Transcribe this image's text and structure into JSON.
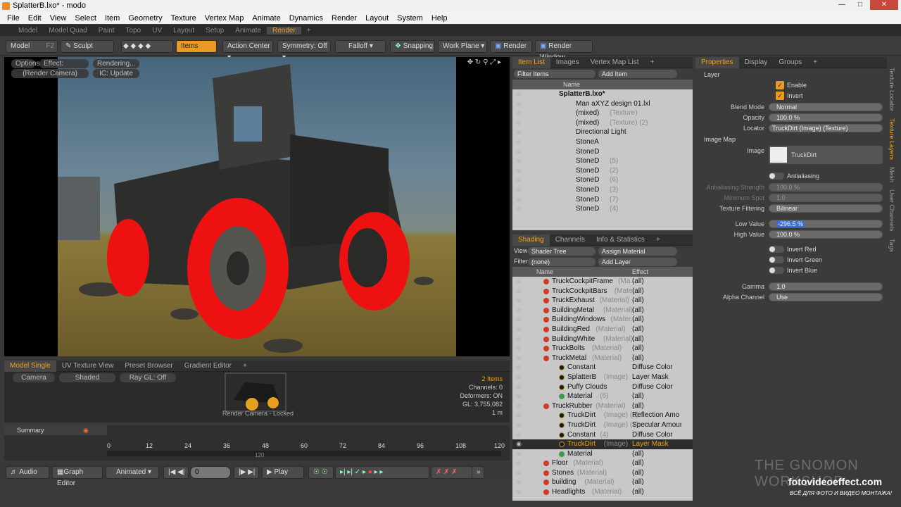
{
  "window": {
    "title": "SplatterB.lxo* - modo"
  },
  "menu": [
    "File",
    "Edit",
    "View",
    "Select",
    "Item",
    "Geometry",
    "Texture",
    "Vertex Map",
    "Animate",
    "Dynamics",
    "Render",
    "Layout",
    "System",
    "Help"
  ],
  "layout_tabs": [
    "Model",
    "Model Quad",
    "Paint",
    "Topo",
    "UV",
    "Layout",
    "Setup",
    "Animate",
    "Render"
  ],
  "toolbar": {
    "model": "Model",
    "model_key": "F2",
    "sculpt": "Sculpt",
    "items": "Items",
    "action_center": "Action Center",
    "symmetry": "Symmetry: Off",
    "falloff": "Falloff",
    "snapping": "Snapping",
    "work_plane": "Work Plane",
    "render": "Render",
    "render_window": "Render Window"
  },
  "viewport": {
    "options": "Options",
    "effect": "Effect: (Shadi...",
    "rendering": "Rendering...",
    "camera": "(Render Camera)",
    "ic": "IC: Update"
  },
  "bottom_tabs": [
    "Model Single",
    "UV Texture View",
    "Preset Browser",
    "Gradient Editor"
  ],
  "preview": {
    "camera": "Camera",
    "shaded": "Shaded",
    "raygl": "Ray GL: Off",
    "items": "2 Items",
    "channels": "Channels: 0",
    "deformers": "Deformers: ON",
    "gl": "GL: 3,755,082",
    "scale": "1 m",
    "locked": "Render Camera - Locked"
  },
  "timeline": {
    "summary": "Summary",
    "ticks": [
      "0",
      "12",
      "24",
      "36",
      "48",
      "60",
      "72",
      "84",
      "96",
      "108",
      "120"
    ],
    "end": "120"
  },
  "transport": {
    "audio": "Audio",
    "graph_editor": "Graph Editor",
    "animated": "Animated",
    "frame": "0",
    "play": "Play"
  },
  "item_list": {
    "tabs": [
      "Item List",
      "Images",
      "Vertex Map List"
    ],
    "filter": "Filter Items",
    "add": "Add Item",
    "col_name": "Name",
    "rows": [
      {
        "name": "SplatterB.lxo*",
        "sub": ""
      },
      {
        "name": "Man aXYZ design 01.lxl",
        "sub": ""
      },
      {
        "name": "(mixed)",
        "sub": "(Texture)"
      },
      {
        "name": "(mixed)",
        "sub": "(Texture) (2)"
      },
      {
        "name": "Directional Light",
        "sub": ""
      },
      {
        "name": "StoneA",
        "sub": ""
      },
      {
        "name": "StoneD",
        "sub": ""
      },
      {
        "name": "StoneD",
        "sub": "(5)"
      },
      {
        "name": "StoneD",
        "sub": "(2)"
      },
      {
        "name": "StoneD",
        "sub": "(6)"
      },
      {
        "name": "StoneD",
        "sub": "(3)"
      },
      {
        "name": "StoneD",
        "sub": "(7)"
      },
      {
        "name": "StoneD",
        "sub": "(4)"
      }
    ]
  },
  "shading": {
    "tabs": [
      "Shading",
      "Channels",
      "Info & Statistics"
    ],
    "view_label": "View",
    "view": "Shader Tree",
    "assign": "Assign Material",
    "filter_label": "Filter",
    "filter": "(none)",
    "add_layer": "Add Layer",
    "col_name": "Name",
    "col_effect": "Effect",
    "rows": [
      {
        "name": "TruckCockpitFrame",
        "sub": "(Ma...",
        "effect": "(all)",
        "dot": "red"
      },
      {
        "name": "TruckCockpitBars",
        "sub": "(Mate...",
        "effect": "(all)",
        "dot": "red"
      },
      {
        "name": "TruckExhaust",
        "sub": "(Material)",
        "effect": "(all)",
        "dot": "red"
      },
      {
        "name": "BuildingMetal",
        "sub": "(Material)",
        "effect": "(all)",
        "dot": "red"
      },
      {
        "name": "BuildingWindows",
        "sub": "(Mater...",
        "effect": "(all)",
        "dot": "red"
      },
      {
        "name": "BuildingRed",
        "sub": "(Material)",
        "effect": "(all)",
        "dot": "red"
      },
      {
        "name": "BuildingWhite",
        "sub": "(Material)",
        "effect": "(all)",
        "dot": "red"
      },
      {
        "name": "TruckBolts",
        "sub": "(Material)",
        "effect": "(all)",
        "dot": "red"
      },
      {
        "name": "TruckMetal",
        "sub": "(Material)",
        "effect": "(all)",
        "dot": "red"
      },
      {
        "name": "Constant",
        "sub": "",
        "effect": "Diffuse Color",
        "dot": "black"
      },
      {
        "name": "SplatterB",
        "sub": "(Image)",
        "effect": "Layer Mask",
        "dot": "black"
      },
      {
        "name": "Puffy Clouds",
        "sub": "",
        "effect": "Diffuse Color",
        "dot": "black"
      },
      {
        "name": "Material",
        "sub": "(6)",
        "effect": "(all)",
        "dot": "green"
      },
      {
        "name": "TruckRubber",
        "sub": "(Material)",
        "effect": "(all)",
        "dot": "red"
      },
      {
        "name": "TruckDirt",
        "sub": "(Image) (3)",
        "effect": "Reflection Amo ...",
        "dot": "black"
      },
      {
        "name": "TruckDirt",
        "sub": "(Image) (2)",
        "effect": "Specular Amount",
        "dot": "black"
      },
      {
        "name": "Constant",
        "sub": "(4)",
        "effect": "Diffuse Color",
        "dot": "black"
      },
      {
        "name": "TruckDirt",
        "sub": "(Image)",
        "effect": "Layer Mask",
        "dot": "black"
      },
      {
        "name": "Material",
        "sub": "",
        "effect": "(all)",
        "dot": "green"
      },
      {
        "name": "Floor",
        "sub": "(Material)",
        "effect": "(all)",
        "dot": "red"
      },
      {
        "name": "Stones",
        "sub": "(Material)",
        "effect": "(all)",
        "dot": "red"
      },
      {
        "name": "building",
        "sub": "(Material)",
        "effect": "(all)",
        "dot": "red"
      },
      {
        "name": "Headlights",
        "sub": "(Material)",
        "effect": "(all)",
        "dot": "red"
      }
    ]
  },
  "properties": {
    "tabs": [
      "Properties",
      "Display",
      "Groups"
    ],
    "section_layer": "Layer",
    "enable": "Enable",
    "invert": "Invert",
    "blend_mode_label": "Blend Mode",
    "blend_mode": "Normal",
    "opacity_label": "Opacity",
    "opacity": "100.0 %",
    "locator_label": "Locator",
    "locator": "TruckDirt (Image) (Texture)",
    "section_image_map": "Image Map",
    "image_label": "Image",
    "image": "TruckDirt",
    "antialiasing": "Antialiasing",
    "aa_strength_label": "Antialiasing Strength",
    "aa_strength": "100.0 %",
    "min_spot_label": "Minimum Spot",
    "min_spot": "1.0",
    "tex_filter_label": "Texture Filtering",
    "tex_filter": "Bilinear",
    "low_label": "Low Value",
    "low": "-296.5 %",
    "high_label": "High Value",
    "high": "100.0 %",
    "invert_red": "Invert Red",
    "invert_green": "Invert Green",
    "invert_blue": "Invert Blue",
    "gamma_label": "Gamma",
    "gamma": "1.0",
    "alpha_label": "Alpha Channel",
    "alpha": "Use",
    "side_tabs": [
      "Texture Locator",
      "Texture Layers",
      "Mesh",
      "User Channels",
      "Tags"
    ]
  },
  "watermark": {
    "site": "fotovideoeffect.com",
    "tagline": "ВСЁ ДЛЯ ФОТО И ВИДЕО МОНТАЖА!",
    "brand": "THE GNOMON WORKSHOP"
  }
}
